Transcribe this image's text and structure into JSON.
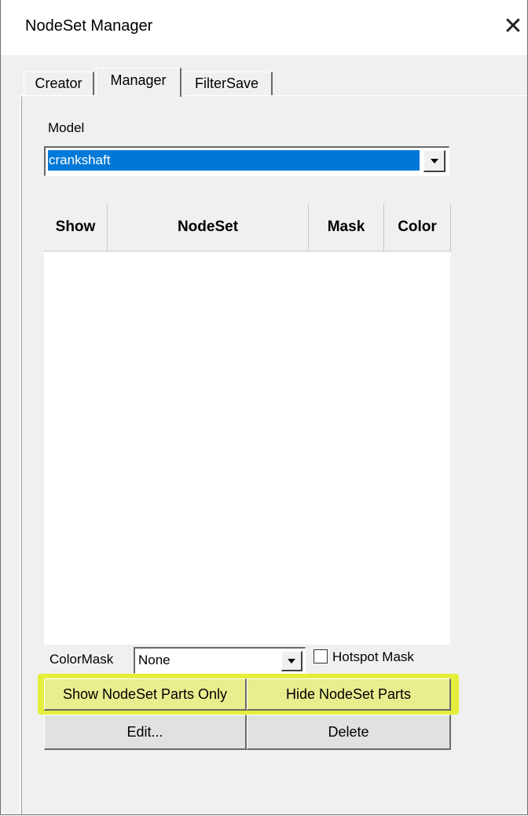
{
  "window": {
    "title": "NodeSet Manager",
    "close_glyph": "✕"
  },
  "tabs": [
    {
      "label": "Creator",
      "active": false
    },
    {
      "label": "Manager",
      "active": true
    },
    {
      "label": "FilterSave",
      "active": false
    }
  ],
  "model": {
    "label": "Model",
    "selected": "crankshaft"
  },
  "table": {
    "columns": [
      "Show",
      "NodeSet",
      "Mask",
      "Color"
    ],
    "rows": []
  },
  "colormask": {
    "label": "ColorMask",
    "selected": "None"
  },
  "hotspot": {
    "label": "Hotspot Mask",
    "checked": false
  },
  "buttons": {
    "show_only": "Show NodeSet Parts Only",
    "hide": "Hide NodeSet Parts",
    "edit": "Edit...",
    "delete": "Delete"
  },
  "colors": {
    "selection": "#0078d7",
    "highlight": "#e5ee3a"
  }
}
